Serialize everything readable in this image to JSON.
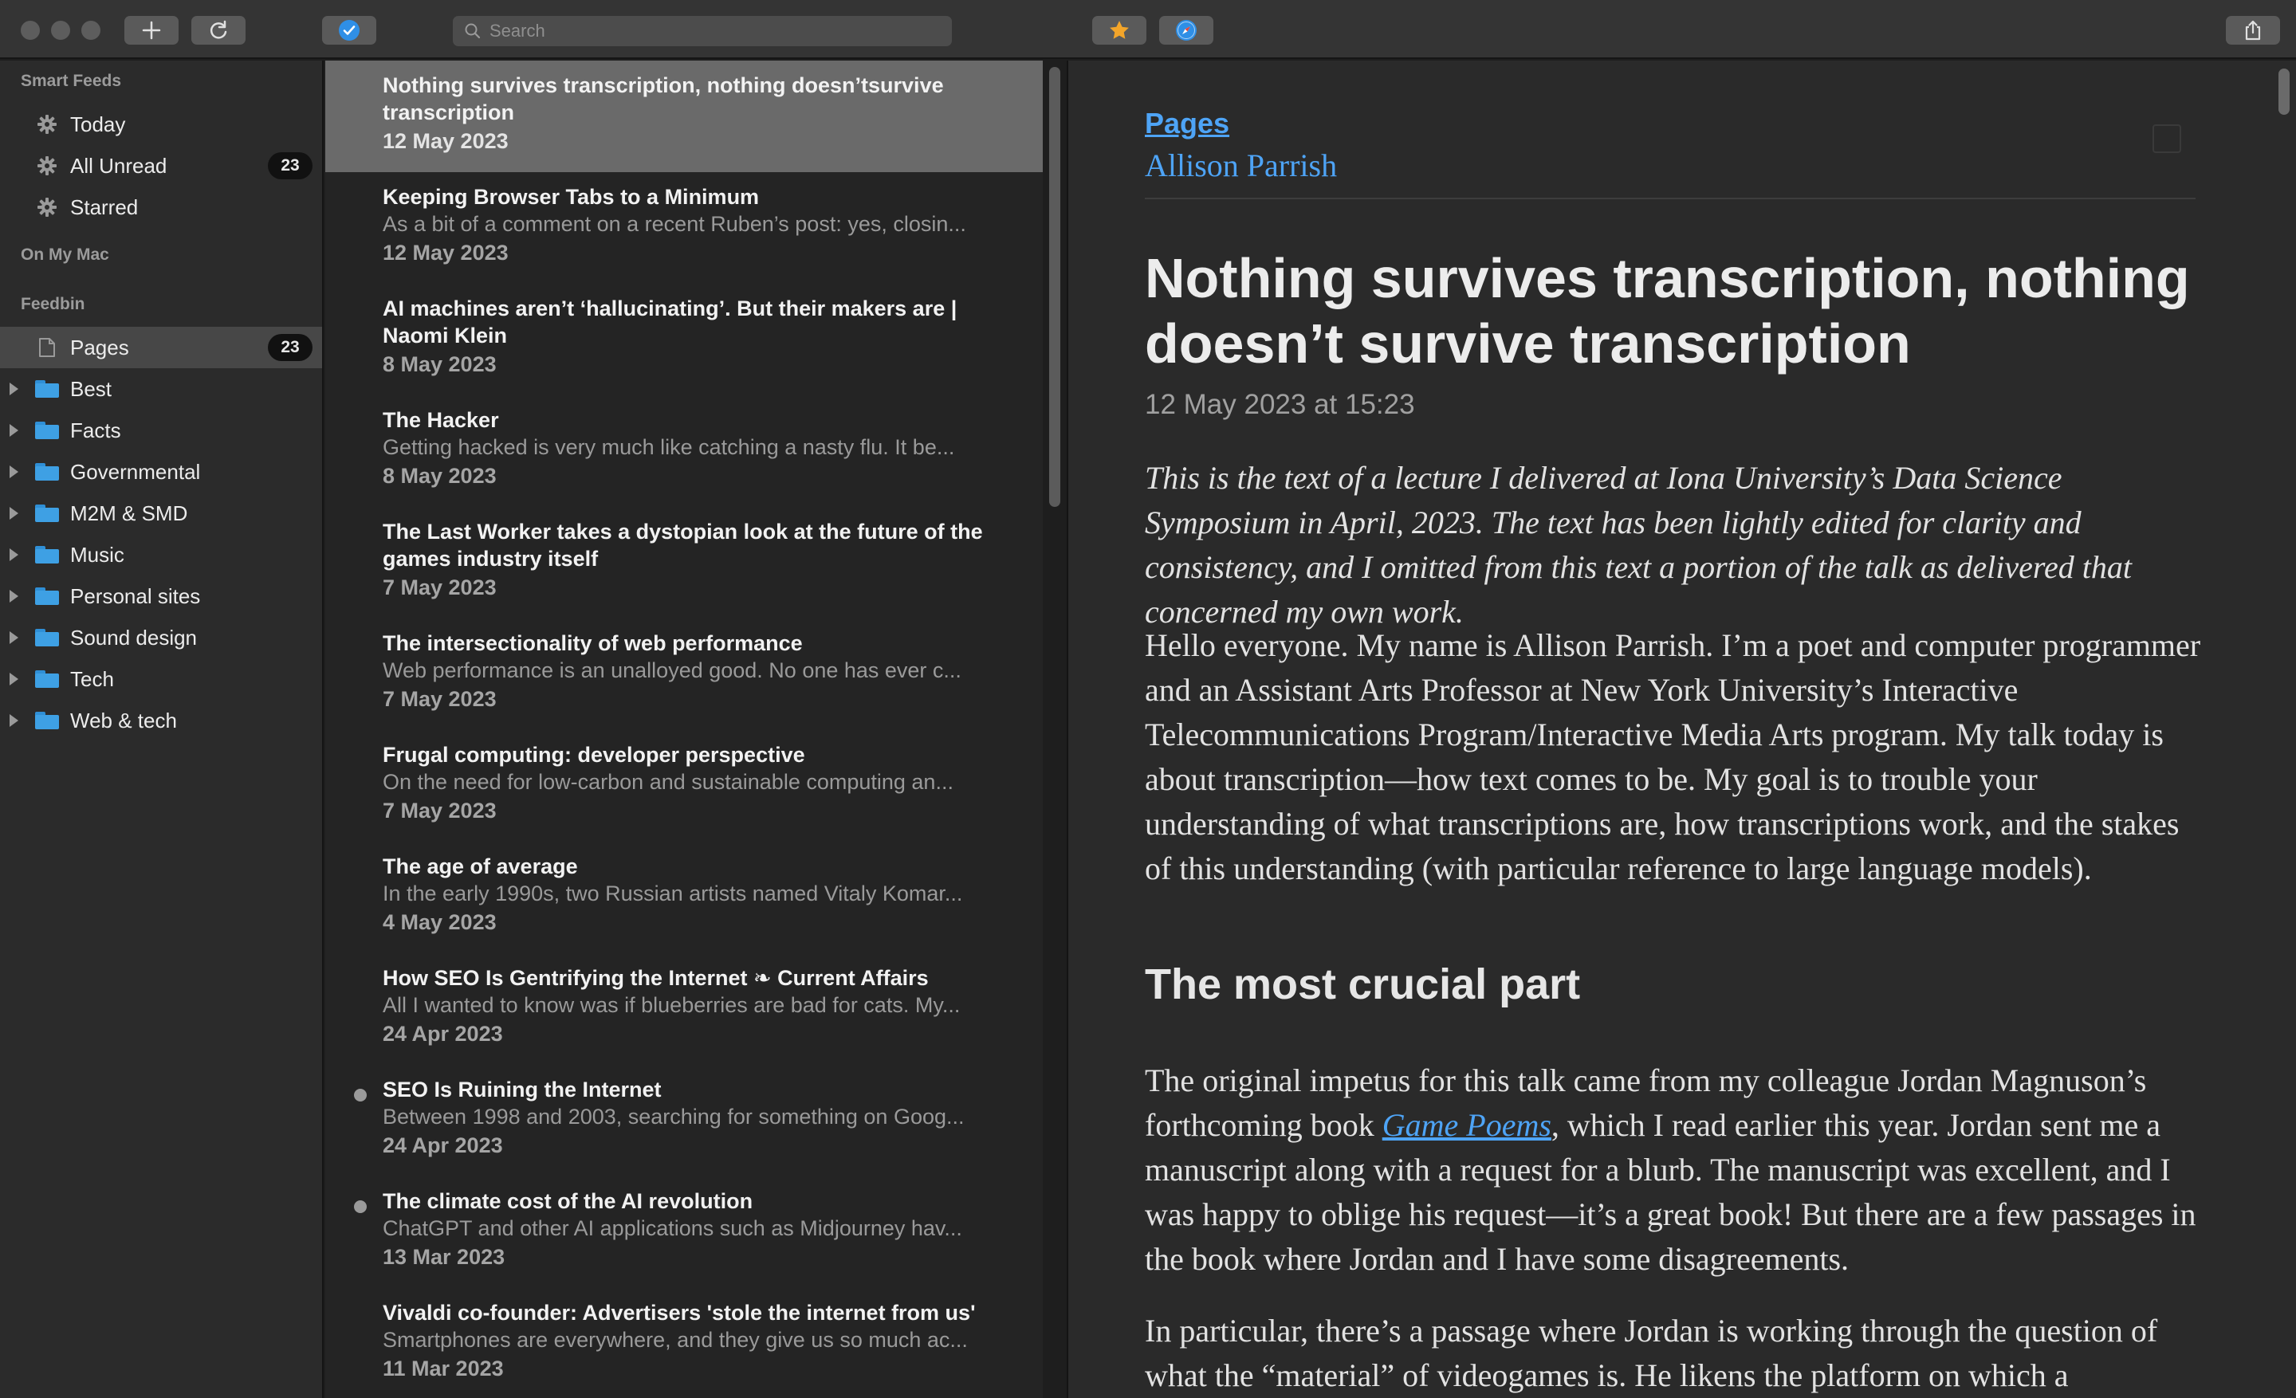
{
  "toolbar": {
    "search_placeholder": "Search"
  },
  "sidebar": {
    "smart_feeds_header": "Smart Feeds",
    "smart_feeds": [
      {
        "label": "Today",
        "badge": ""
      },
      {
        "label": "All Unread",
        "badge": "23"
      },
      {
        "label": "Starred",
        "badge": ""
      }
    ],
    "on_my_mac_header": "On My Mac",
    "feedbin_header": "Feedbin",
    "pages": {
      "label": "Pages",
      "badge": "23"
    },
    "folders": [
      "Best",
      "Facts",
      "Governmental",
      "M2M & SMD",
      "Music",
      "Personal sites",
      "Sound design",
      "Tech",
      "Web & tech"
    ]
  },
  "articles": [
    {
      "title": "Nothing survives transcription, nothing doesn’tsurvive transcription",
      "snippet": "",
      "date": "12 May 2023",
      "unread": false
    },
    {
      "title": "Keeping Browser Tabs to a Minimum",
      "snippet": "As a bit of a comment on a recent Ruben’s post: yes, closin...",
      "date": "12 May 2023",
      "unread": false
    },
    {
      "title": "AI machines aren’t ‘hallucinating’. But their makers are | Naomi Klein",
      "snippet": "",
      "date": "8 May 2023",
      "unread": false
    },
    {
      "title": "The Hacker",
      "snippet": "Getting hacked is very much like catching a nasty flu. It be...",
      "date": "8 May 2023",
      "unread": false
    },
    {
      "title": "The Last Worker takes a dystopian look at the future of the games industry itself",
      "snippet": "",
      "date": "7 May 2023",
      "unread": false
    },
    {
      "title": "The intersectionality of web performance",
      "snippet": "Web performance is an unalloyed good. No one has ever c...",
      "date": "7 May 2023",
      "unread": false
    },
    {
      "title": "Frugal computing: developer perspective",
      "snippet": "On the need for low-carbon and sustainable computing an...",
      "date": "7 May 2023",
      "unread": false
    },
    {
      "title": "The age of average",
      "snippet": "In the early 1990s, two Russian artists named Vitaly Komar...",
      "date": "4 May 2023",
      "unread": false
    },
    {
      "title": "How SEO Is Gentrifying the Internet ❧ Current Affairs",
      "snippet": "All I wanted to know was if blueberries are bad for cats. My...",
      "date": "24 Apr 2023",
      "unread": false
    },
    {
      "title": "SEO Is Ruining the Internet",
      "snippet": "Between 1998 and 2003, searching for something on Goog...",
      "date": "24 Apr 2023",
      "unread": true
    },
    {
      "title": "The climate cost of the AI revolution",
      "snippet": "ChatGPT and other AI applications such as Midjourney hav...",
      "date": "13 Mar 2023",
      "unread": true
    },
    {
      "title": "Vivaldi co-founder: Advertisers 'stole the internet from us'",
      "snippet": "Smartphones are everywhere, and they give us so much ac...",
      "date": "11 Mar 2023",
      "unread": false
    }
  ],
  "reader": {
    "feed_name": "Pages",
    "author": "Allison Parrish",
    "title": "Nothing survives transcription, nothing doesn’t survive transcription",
    "date": "12 May 2023 at 15:23",
    "intro": "This is the text of a lecture I delivered at Iona University’s Data Science Symposium in April, 2023. The text has been lightly edited for clarity and consistency, and I omitted from this text a portion of the talk as delivered that concerned my own work.",
    "para1": "Hello everyone. My name is Allison Parrish. I’m a poet and computer programmer and an Assistant Arts Professor at New York University’s Interactive Telecommunications Program/Interactive Media Arts program. My talk today is about transcription—how text comes to be. My goal is to trouble your understanding of what transcriptions are, how transcriptions work, and the stakes of this understanding (with particular reference to large language models).",
    "heading": "The most crucial part",
    "para2_before": "The original impetus for this talk came from my colleague Jordan Magnuson’s forthcoming book ",
    "para2_link": "Game Poems",
    "para2_after": ", which I read earlier this year. Jordan sent me a manuscript along with a request for a blurb. The manuscript was excellent, and I was happy to oblige his request—it’s a great book! But there are a few passages in the book where Jordan and I have some disagreements.",
    "para3": "In particular, there’s a passage where Jordan is working through the question of what the “material” of videogames is. He likens the platform on which a"
  },
  "colors": {
    "accent": "#4ea4f6",
    "folder": "#3ea0e4"
  }
}
